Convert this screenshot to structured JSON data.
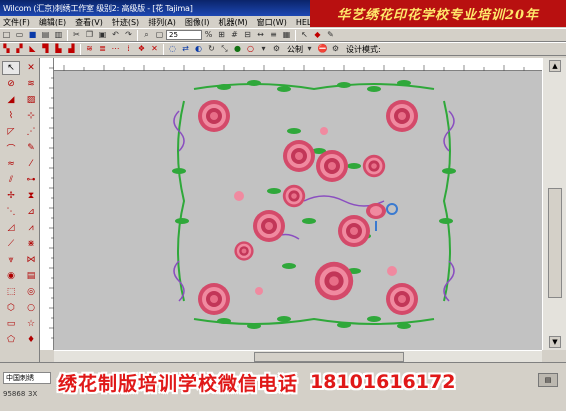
{
  "window": {
    "title": "Wilcom (汇京)刺绣工作室   级别2: 高级版 - [花        Tajima]"
  },
  "banner": {
    "text": "华艺绣花印花学校专业培训20年"
  },
  "menu": [
    "文件(F)",
    "编辑(E)",
    "查看(V)",
    "针迹(S)",
    "排列(A)",
    "图像(I)",
    "机器(M)",
    "窗口(W)",
    "HELP"
  ],
  "toolbar": {
    "zoom_value": "25",
    "mode_value": "公制",
    "design_mode_label": "设计模式:"
  },
  "status": {
    "field": "中国刺绣",
    "count": "95868",
    "unit": "3X"
  },
  "promo": {
    "text": "绣花制版培训学校微信电话",
    "phone": "18101616172"
  },
  "colors": {
    "rose": "#d44a6a",
    "rose_light": "#f08aa0",
    "leaf": "#2fa83a",
    "purple": "#8a4ec0",
    "canvas": "#c2c2c2"
  }
}
